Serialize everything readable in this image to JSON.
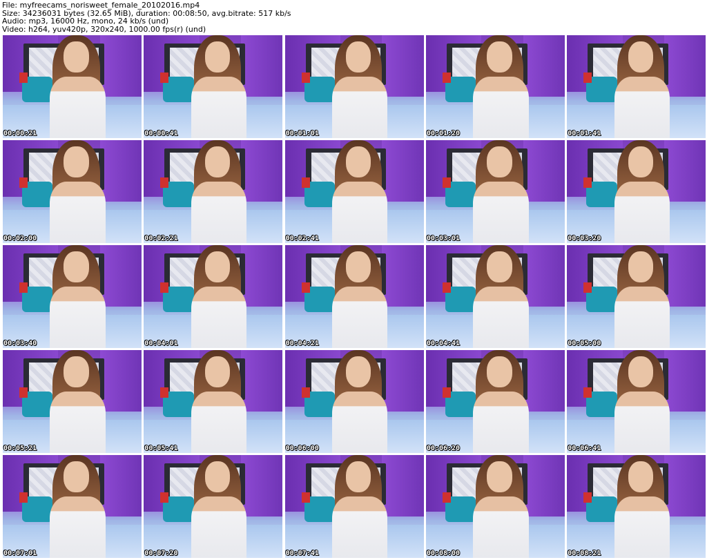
{
  "header": {
    "file": "File: myfreecams_norisweet_female_20102016.mp4",
    "size": "Size: 34236031 bytes (32.65 MiB), duration: 00:08:50, avg.bitrate: 517 kb/s",
    "audio": "Audio: mp3, 16000 Hz, mono, 24 kb/s (und)",
    "video": "Video: h264, yuv420p, 320x240, 1000.00 fps(r) (und)"
  },
  "thumbnails": [
    {
      "timestamp": "00:00:21"
    },
    {
      "timestamp": "00:00:41"
    },
    {
      "timestamp": "00:01:01"
    },
    {
      "timestamp": "00:01:20"
    },
    {
      "timestamp": "00:01:41"
    },
    {
      "timestamp": "00:02:00"
    },
    {
      "timestamp": "00:02:21"
    },
    {
      "timestamp": "00:02:41"
    },
    {
      "timestamp": "00:03:01"
    },
    {
      "timestamp": "00:03:20"
    },
    {
      "timestamp": "00:03:40"
    },
    {
      "timestamp": "00:04:01"
    },
    {
      "timestamp": "00:04:21"
    },
    {
      "timestamp": "00:04:41"
    },
    {
      "timestamp": "00:05:00"
    },
    {
      "timestamp": "00:05:21"
    },
    {
      "timestamp": "00:05:41"
    },
    {
      "timestamp": "00:06:00"
    },
    {
      "timestamp": "00:06:20"
    },
    {
      "timestamp": "00:06:41"
    },
    {
      "timestamp": "00:07:01"
    },
    {
      "timestamp": "00:07:20"
    },
    {
      "timestamp": "00:07:41"
    },
    {
      "timestamp": "00:08:00"
    },
    {
      "timestamp": "00:08:21"
    }
  ]
}
